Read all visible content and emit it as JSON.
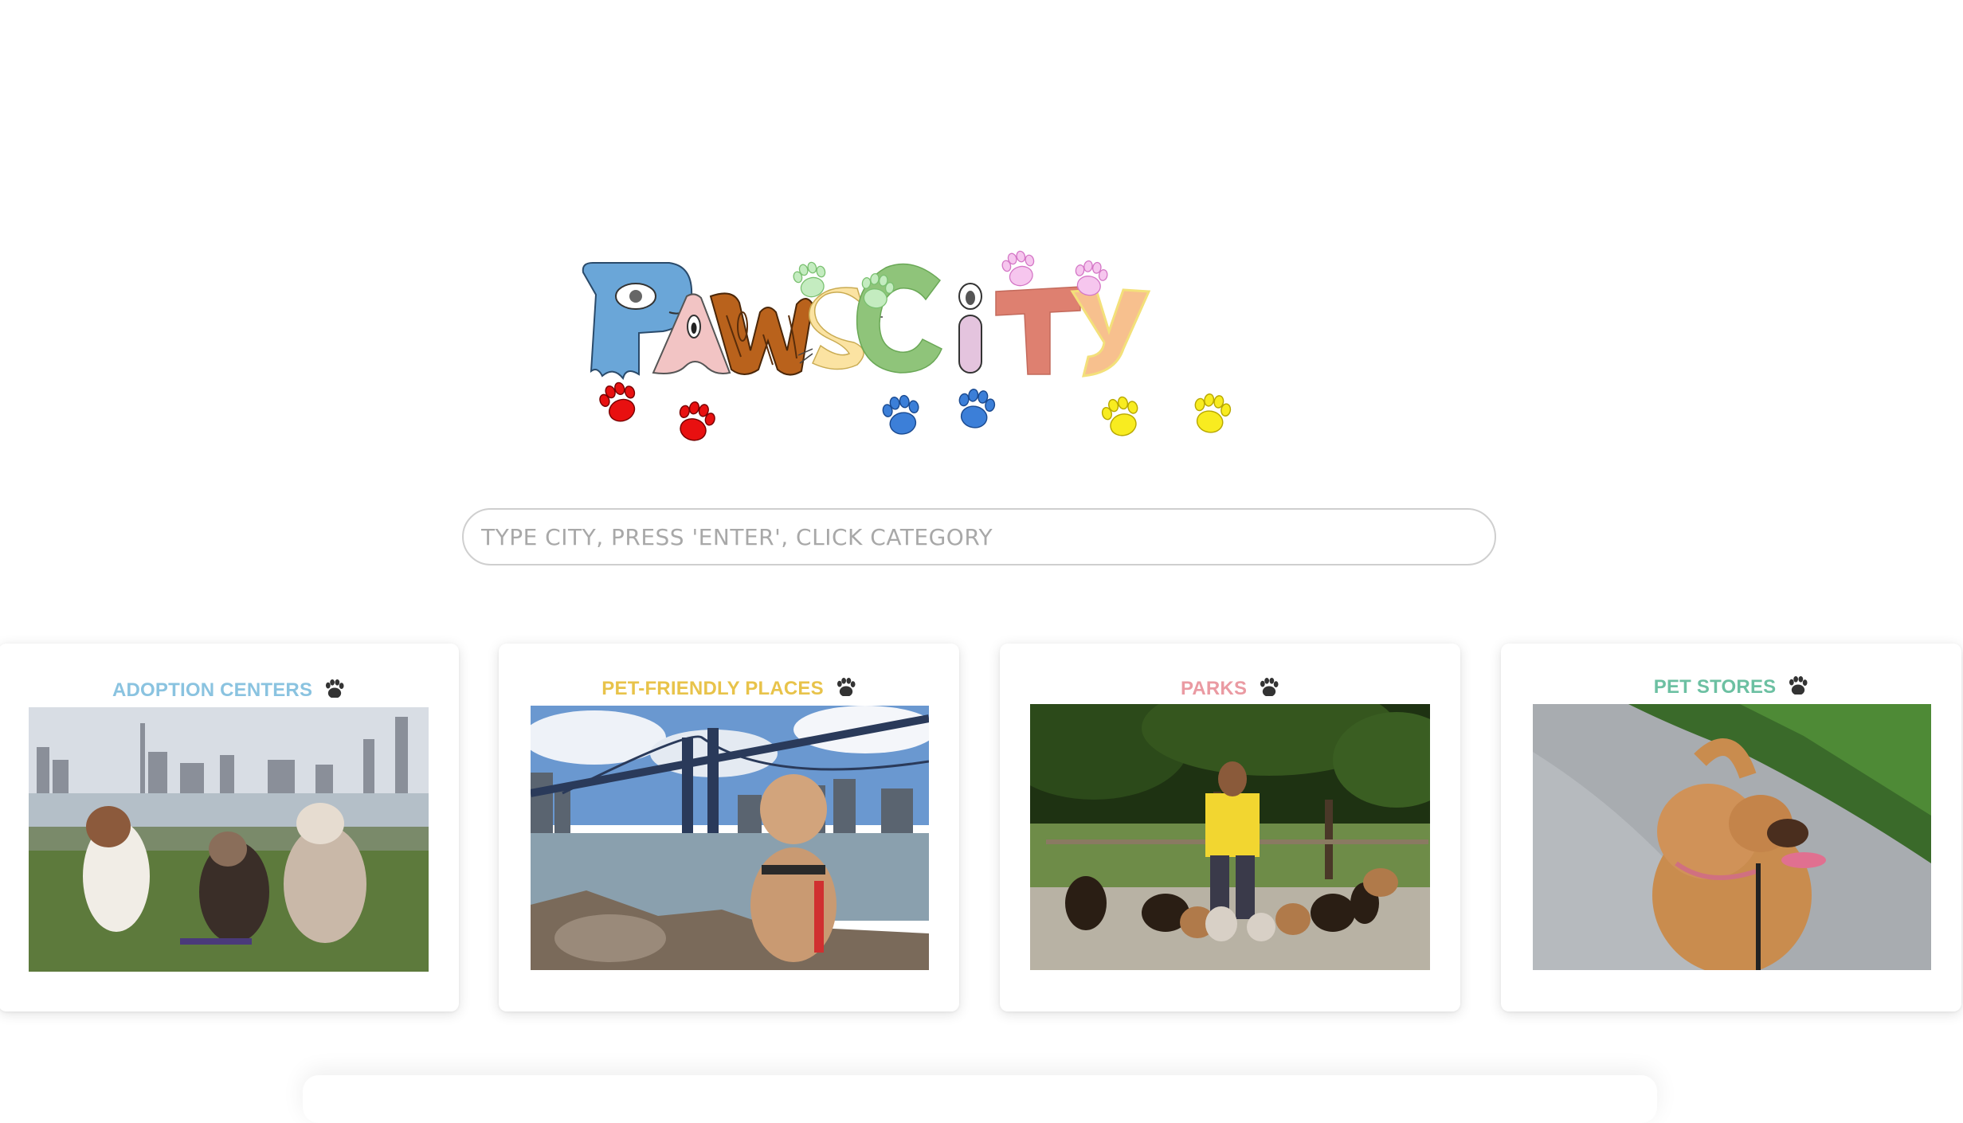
{
  "logo": {
    "text": "Paws City"
  },
  "search": {
    "placeholder": "TYPE CITY, PRESS 'ENTER', CLICK CATEGORY",
    "value": ""
  },
  "categories": [
    {
      "label": "ADOPTION CENTERS",
      "color": "#8ac3e0",
      "icon": "paw-icon",
      "image": "three dogs sitting on grass by the river with city skyline"
    },
    {
      "label": "PET-FRIENDLY PLACES",
      "color": "#e8c34a",
      "icon": "paw-icon",
      "image": "dog sitting on rocks in front of a bridge"
    },
    {
      "label": "PARKS",
      "color": "#ea9aa2",
      "icon": "paw-icon",
      "image": "dog walker with many dogs in a park"
    },
    {
      "label": "PET STORES",
      "color": "#6cc0a2",
      "icon": "paw-icon",
      "image": "small tan dog on a leash on a path"
    }
  ]
}
